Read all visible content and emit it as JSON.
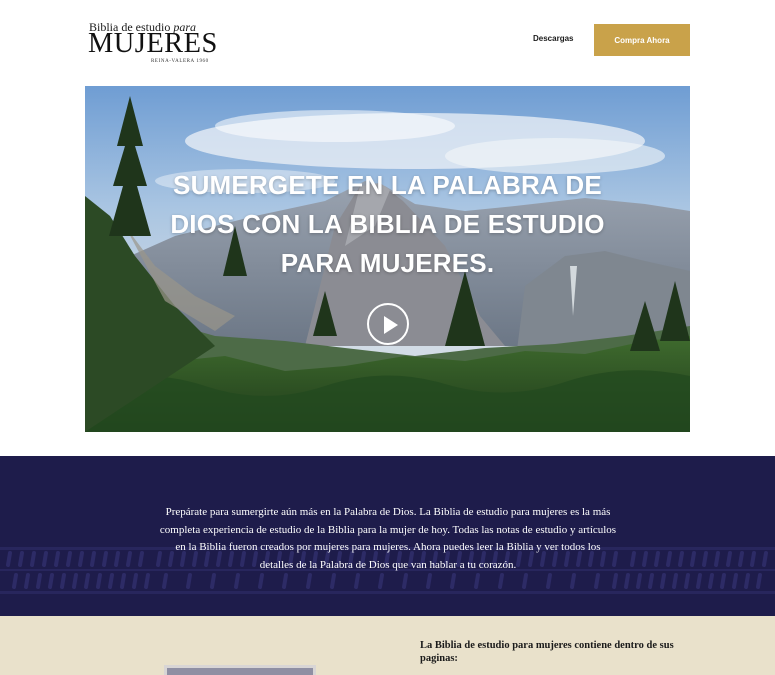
{
  "header": {
    "logo": {
      "line1_start": "Biblia de estudio ",
      "line1_italic": "para",
      "main": "MUJERES",
      "sub": "REINA-VALERA 1960"
    },
    "nav": {
      "downloads_label": "Descargas",
      "buy_label": "Compra Ahora"
    }
  },
  "hero": {
    "title": "SUMERGETE EN LA PALABRA DE DIOS CON LA BIBLIA DE ESTUDIO PARA MUJERES.",
    "play_icon": "play-icon"
  },
  "intro": {
    "text": "Prepárate para sumergirte aún más en la Palabra de Dios. La Biblia de estudio para mujeres es la más completa experiencia de estudio de la Biblia para la mujer de hoy. Todas las notas de estudio y artículos en la Biblia fueron creados por mujeres para mujeres. Ahora puedes leer la Biblia y ver todos los detalles de la Palabra de Dios que van hablar a tu corazón."
  },
  "features": {
    "heading": "La Biblia de estudio para mujeres contiene dentro de sus paginas:"
  },
  "colors": {
    "accent_gold": "#c9a24a",
    "navy": "#1e1c4b",
    "beige": "#e9e1cb"
  }
}
